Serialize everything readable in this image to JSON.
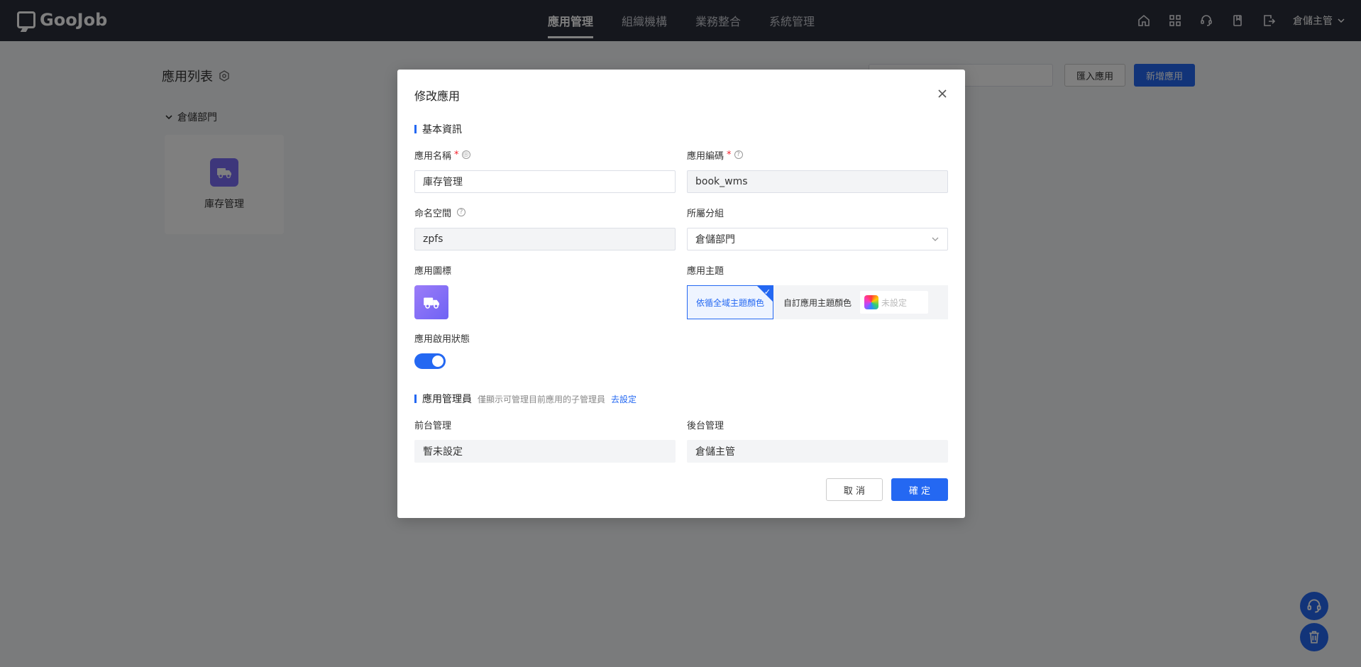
{
  "brand": {
    "name": "GooJob"
  },
  "nav": {
    "items": [
      {
        "label": "應用管理",
        "active": true
      },
      {
        "label": "組織機構",
        "active": false
      },
      {
        "label": "業務整合",
        "active": false
      },
      {
        "label": "系統管理",
        "active": false
      }
    ]
  },
  "topbar": {
    "icons": [
      "home-icon",
      "grid-icon",
      "support-icon",
      "book-icon",
      "export-icon"
    ],
    "user_name": "倉儲主管"
  },
  "page": {
    "title": "應用列表",
    "import_label": "匯入應用",
    "add_label": "新增應用",
    "group_name": "倉儲部門",
    "apps": [
      {
        "name": "庫存管理"
      }
    ]
  },
  "modal": {
    "title": "修改應用",
    "basic_section": "基本資訊",
    "app_name": {
      "label": "應用名稱",
      "value": "庫存管理"
    },
    "app_code": {
      "label": "應用編碼",
      "value": "book_wms"
    },
    "namespace": {
      "label": "命名空間",
      "value": "zpfs"
    },
    "group": {
      "label": "所屬分組",
      "value": "倉儲部門"
    },
    "app_icon": {
      "label": "應用圖標"
    },
    "theme": {
      "label": "應用主題",
      "global_option": "依循全域主題顏色",
      "custom_label": "自訂應用主題顏色",
      "custom_placeholder": "未設定"
    },
    "status": {
      "label": "應用啟用狀態",
      "enabled": true
    },
    "admin_section": {
      "title": "應用管理員",
      "hint": "僅顯示可管理目前應用的子管理員",
      "link": "去設定"
    },
    "frontend_admin": {
      "label": "前台管理",
      "value": "暫未設定"
    },
    "backend_admin": {
      "label": "後台管理",
      "value": "倉儲主管"
    },
    "cancel_label": "取 消",
    "confirm_label": "確 定"
  },
  "colors": {
    "primary": "#2468f2",
    "topbar": "#2b2f3a",
    "app_icon": "#7b6cf6"
  }
}
